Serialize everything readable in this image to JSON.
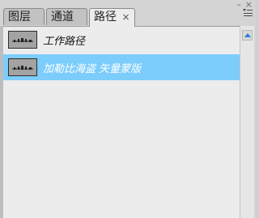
{
  "panel": {
    "controls": {
      "collapse": "–",
      "close": "×"
    },
    "tabs": [
      {
        "label": "图层"
      },
      {
        "label": "通道"
      },
      {
        "label": "路径",
        "close": "×",
        "active": true
      }
    ],
    "menu_icon": "panel-menu-icon"
  },
  "paths": [
    {
      "label": "工作路径",
      "selected": false
    },
    {
      "label": "加勒比海盗 矢量蒙版",
      "selected": true
    }
  ],
  "colors": {
    "selected_row": "#7ccdfb",
    "scroll_arrow": "#2b7fd6"
  }
}
